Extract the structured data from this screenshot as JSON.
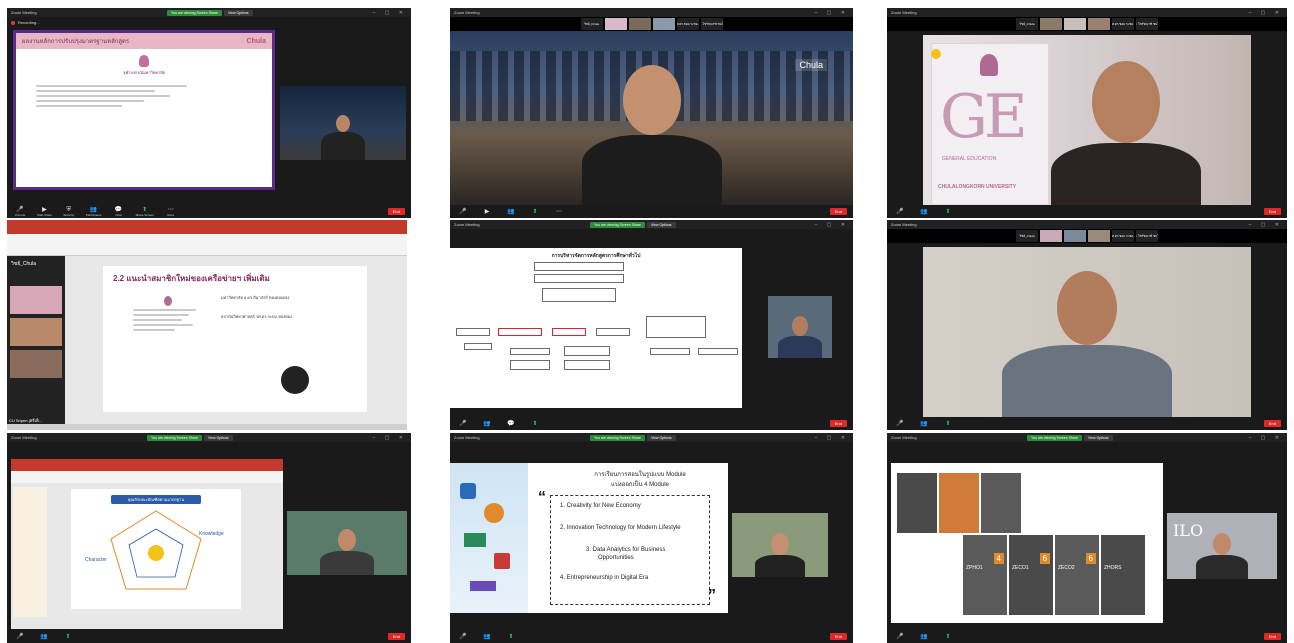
{
  "zoom": {
    "window_title": "Zoom Meeting",
    "recording": "Recording...",
    "view": "View",
    "view_options": "View Options",
    "end": "End",
    "screen_share_banner": "You are viewing Screen Share",
    "toolbar": [
      "Unmute",
      "Start Video",
      "Security",
      "Participants",
      "Polls",
      "Chat",
      "Share Screen",
      "Pause/Stop Recording",
      "Breakout Rooms",
      "Reactions",
      "More"
    ]
  },
  "colors": {
    "zoom_bg": "#1a1a1a",
    "share_green": "#2e8b3a",
    "end_red": "#e02828",
    "chula_pink": "#d88aa8"
  },
  "panels": {
    "p1": {
      "header": "ผลงานหลักการปรับปรุงมาตรฐานหลักสูตร",
      "logo": "Chula",
      "subtitle": "จุฬาลงกรณ์มหาวิทยาลัย"
    },
    "p2": {
      "thumb_names": [
        "วิชย์_Chula",
        "รศ.ดร.ชอม ระชอ...",
        "ผศ. ไชรัชณาฑ์ ชนไ..."
      ],
      "logo": "Chula"
    },
    "p3": {
      "thumb_names": [
        "วิชย์_Chula",
        "รศ.ดร.ชอม ระชอ...",
        "ผศ. ไชรัชณาฑ์ ชนไ..."
      ],
      "sign_letters": "GE",
      "sign_text1": "GENERAL EDUCATION",
      "sign_text2": "CHULALONGKORN UNIVERSITY"
    },
    "p4": {
      "slide_title": "2.2 แนะนำสมาชิกใหม่ของเครือข่ายฯ เพิ่มเติม",
      "side_name_top": "วิชย์_Chula",
      "side_name_bottom": "CU Sripen (ศรีเพ็...",
      "bullets": [
        "มหาวิทยาลัย อ.ดร.สิมาภัสร์ ทองคณทอง",
        "สถาบันวิทยาศาสตร์ รศ.ดร.ระบบ ของทอง"
      ]
    },
    "p5": {
      "org_title": "การบริหารจัดการหลักสูตรการศึกษาทั่วไป"
    },
    "p6": {
      "thumb_names": [
        "วิชย์_Chula",
        "รศ.ดร.ชอม ระชอ...",
        "ผศ. ไชรัชณาฑ์ ชนไ..."
      ]
    },
    "p7": {
      "chart_title": "คุณลักษณะบัณฑิตตามมาตรฐาน",
      "labels": [
        "Character",
        "Knowledge"
      ]
    },
    "p8": {
      "title_line1": "การเรียนการสอนในรูปแบบ Module",
      "title_line2": "แบ่งออกเป็น 4 Module",
      "modules": [
        "1.   Creativity for New Economy",
        "2.   Innovation Technology for Modern Lifestyle",
        "3.   Data Analytics for Business",
        "Opportunities",
        "4.   Entrepreneurship in Digital Era"
      ]
    },
    "p9": {
      "course_codes": [
        "ZHORS",
        "ZECO1",
        "ZECO2",
        "ZPHO1"
      ],
      "nums": [
        "4",
        "6",
        "6"
      ],
      "brand": "ILO"
    }
  }
}
